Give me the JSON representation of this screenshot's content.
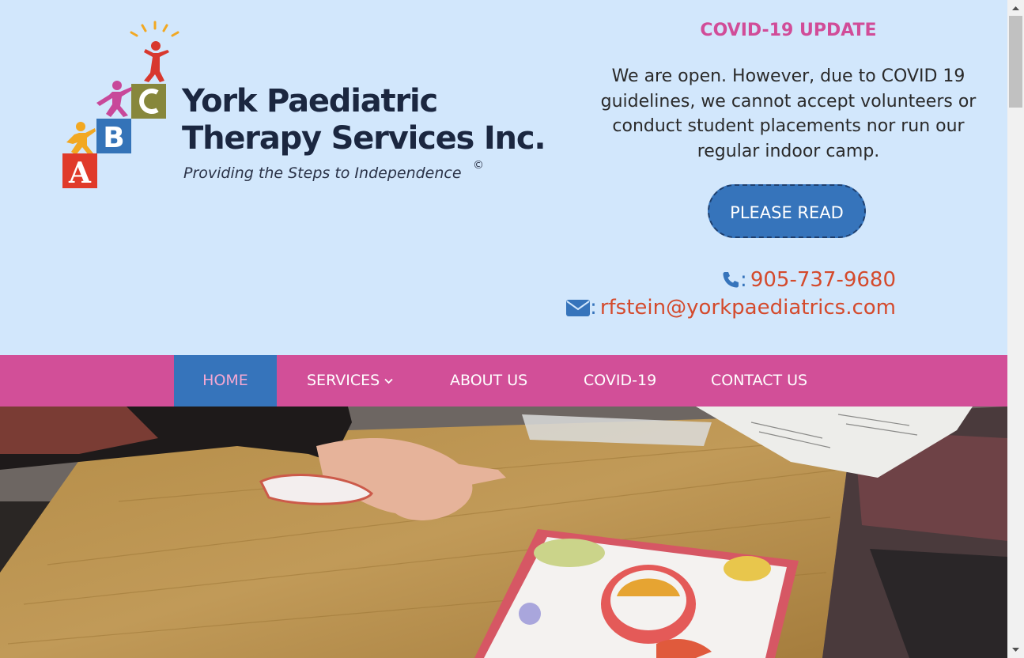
{
  "logo": {
    "line1": "York Paediatric",
    "line2": "Therapy Services Inc.",
    "tagline": "Providing the Steps to Independence",
    "copyright": "©",
    "blocks": [
      "A",
      "B",
      "C"
    ]
  },
  "covid": {
    "title": "COVID-19 UPDATE",
    "body": "We are open.   However, due to COVID 19 guidelines, we cannot accept  volunteers or conduct student placements nor run our regular indoor camp.",
    "button_label": "PLEASE READ"
  },
  "contact": {
    "phone_icon": "phone-icon",
    "phone": "905-737-9680",
    "email_icon": "envelope-icon",
    "email": "rfstein@yorkpaediatrics.com",
    "separator": ":"
  },
  "nav": {
    "items": [
      {
        "label": "HOME",
        "active": true
      },
      {
        "label": "SERVICES",
        "has_dropdown": true
      },
      {
        "label": "ABOUT US"
      },
      {
        "label": "COVID-19"
      },
      {
        "label": "CONTACT US"
      }
    ]
  },
  "colors": {
    "header_bg": "#d2e7fc",
    "nav_bg": "#d24f98",
    "nav_active": "#3674bb",
    "accent_pink": "#d14c98",
    "link_red": "#d44a2c"
  }
}
